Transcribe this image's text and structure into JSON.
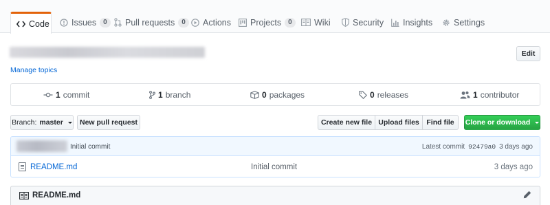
{
  "tabs": [
    {
      "label": "Code",
      "icon": "code-icon",
      "selected": true
    },
    {
      "label": "Issues",
      "icon": "issue-icon",
      "count": "0"
    },
    {
      "label": "Pull requests",
      "icon": "pull-request-icon",
      "count": "0"
    },
    {
      "label": "Actions",
      "icon": "play-icon"
    },
    {
      "label": "Projects",
      "icon": "project-icon",
      "count": "0"
    },
    {
      "label": "Wiki",
      "icon": "book-icon"
    },
    {
      "label": "Security",
      "icon": "shield-icon"
    },
    {
      "label": "Insights",
      "icon": "graph-icon"
    },
    {
      "label": "Settings",
      "icon": "gear-icon"
    }
  ],
  "repo": {
    "manage_topics": "Manage topics",
    "edit_label": "Edit"
  },
  "summary": {
    "commits": {
      "count": "1",
      "label": "commit"
    },
    "branches": {
      "count": "1",
      "label": "branch"
    },
    "packages": {
      "count": "0",
      "label": "packages"
    },
    "releases": {
      "count": "0",
      "label": "releases"
    },
    "contributors": {
      "count": "1",
      "label": "contributor"
    }
  },
  "toolbar": {
    "branch_prefix": "Branch:",
    "branch_name": "master",
    "new_pull_request": "New pull request",
    "create_new_file": "Create new file",
    "upload_files": "Upload files",
    "find_file": "Find file",
    "clone_or_download": "Clone or download"
  },
  "commit_tease": {
    "message": "Initial commit",
    "latest_label": "Latest commit",
    "sha": "92479a0",
    "age": "3 days ago"
  },
  "files": [
    {
      "name": "README.md",
      "message": "Initial commit",
      "age": "3 days ago"
    }
  ],
  "readme": {
    "title": "README.md"
  },
  "colors": {
    "accent_tab": "#e36209",
    "link": "#0366d6",
    "clone_button": "#28a745",
    "commit_tease_bg": "#f1f8ff"
  }
}
